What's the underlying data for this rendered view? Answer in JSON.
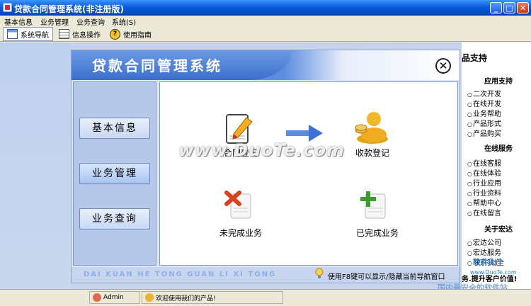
{
  "window": {
    "title": "贷款合同管理系统(非注册版)",
    "min": "_",
    "max": "□",
    "close": "✕"
  },
  "menu": [
    "基本信息",
    "业务管理",
    "业务查询",
    "系统(S)"
  ],
  "toolbar": {
    "nav": "系统导航",
    "info": "信息操作",
    "help": "使用指南"
  },
  "support": {
    "title": "品支持",
    "sections": [
      {
        "heading": "应用支持",
        "items": [
          "二次开发",
          "在线开发",
          "业务帮助",
          "产品形式",
          "产品购买"
        ]
      },
      {
        "heading": "在线服务",
        "items": [
          "在线客服",
          "在线体验",
          "行业应用",
          "行业资料",
          "帮助中心",
          "在线留言"
        ]
      },
      {
        "heading": "关于宏达",
        "items": [
          "宏达公司",
          "宏达服务",
          "联系我们"
        ]
      }
    ],
    "footer": "务.提升客户价值!"
  },
  "dialog": {
    "title": "贷款合同管理系统",
    "close": "✕",
    "side_buttons": [
      "基本信息",
      "业务管理",
      "业务查询"
    ],
    "icons": {
      "contract": "合同登记",
      "payment": "收款登记",
      "unfinished": "未完成业务",
      "finished": "已完成业务"
    },
    "footer_pinyin": "DAI KUAN HE TONG GUAN LI XI TONG",
    "footer_hint": "使用F8键可以显示/隐藏当前导航窗口"
  },
  "watermark": "www.DuoTe.com",
  "status": {
    "user": "Admin",
    "welcome": "欢迎使用我们的产品!"
  },
  "corner": {
    "line1": "软件大全",
    "line2": "www.DuoTe.com",
    "line3": "国内最安全的软件站"
  }
}
